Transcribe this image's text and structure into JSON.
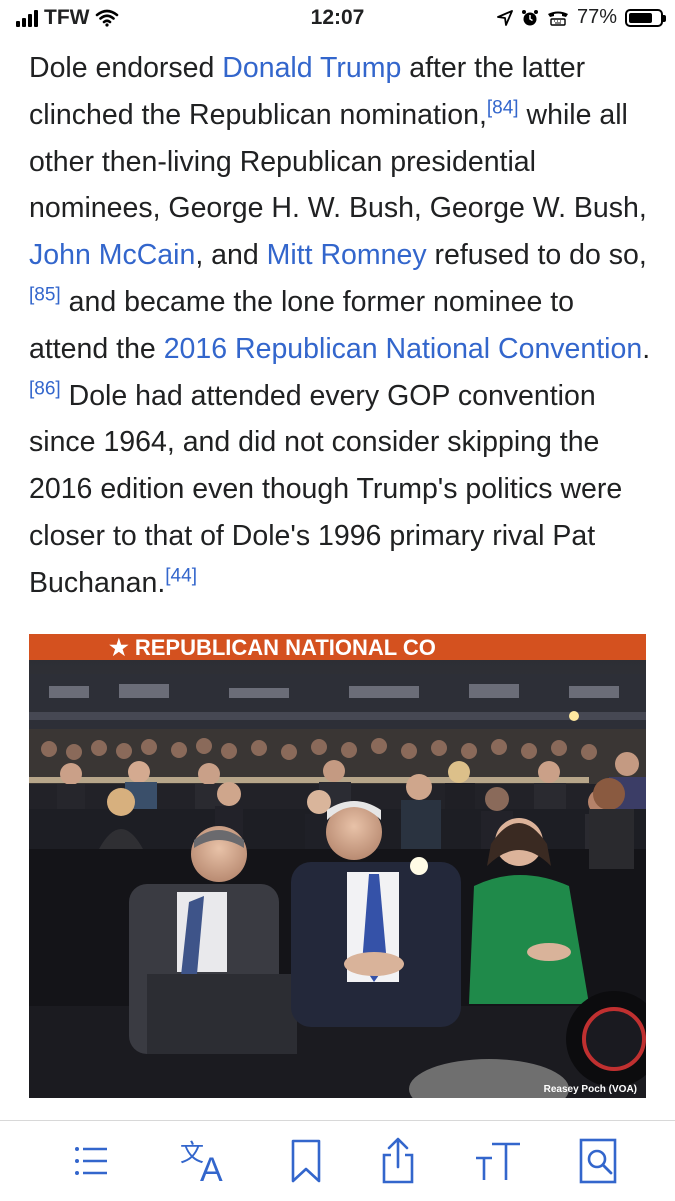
{
  "status_bar": {
    "carrier": "TFW",
    "time": "12:07",
    "battery_percent": "77%",
    "battery_level": 0.77,
    "signal_bars": 4,
    "icons": [
      "signal-icon",
      "wifi-icon",
      "location-icon",
      "alarm-icon",
      "tty-icon",
      "battery-icon"
    ]
  },
  "article": {
    "segments": [
      {
        "t": "Dole endorsed "
      },
      {
        "link": "Donald Trump"
      },
      {
        "t": " after the latter clinched the Republican nomination,"
      },
      {
        "ref": "[84]"
      },
      {
        "t": " while all other then-living Republican presidential nominees, George H. W. Bush, George W. Bush, "
      },
      {
        "link": "John McCain"
      },
      {
        "t": ", and "
      },
      {
        "link": "Mitt Romney"
      },
      {
        "t": " refused to do so,"
      },
      {
        "ref": "[85]"
      },
      {
        "t": " and became the lone former nominee to attend the "
      },
      {
        "link": "2016 Republican National Convention"
      },
      {
        "t": "."
      },
      {
        "ref": "[86]"
      },
      {
        "t": " Dole had attended every GOP convention since 1964, and did not consider skipping the 2016 edition even though Trump's politics were closer to that of Dole's 1996 primary rival Pat Buchanan."
      },
      {
        "ref": "[44]"
      }
    ]
  },
  "photo": {
    "banner_text": "★ REPUBLICAN NATIONAL CO",
    "credit": "Reasey Poch (VOA)"
  },
  "toolbar": {
    "icons": [
      "contents-icon",
      "language-icon",
      "bookmark-icon",
      "share-icon",
      "text-size-icon",
      "find-in-page-icon"
    ],
    "accent": "#3366cc"
  },
  "colors": {
    "link": "#3366cc",
    "text": "#202122"
  }
}
